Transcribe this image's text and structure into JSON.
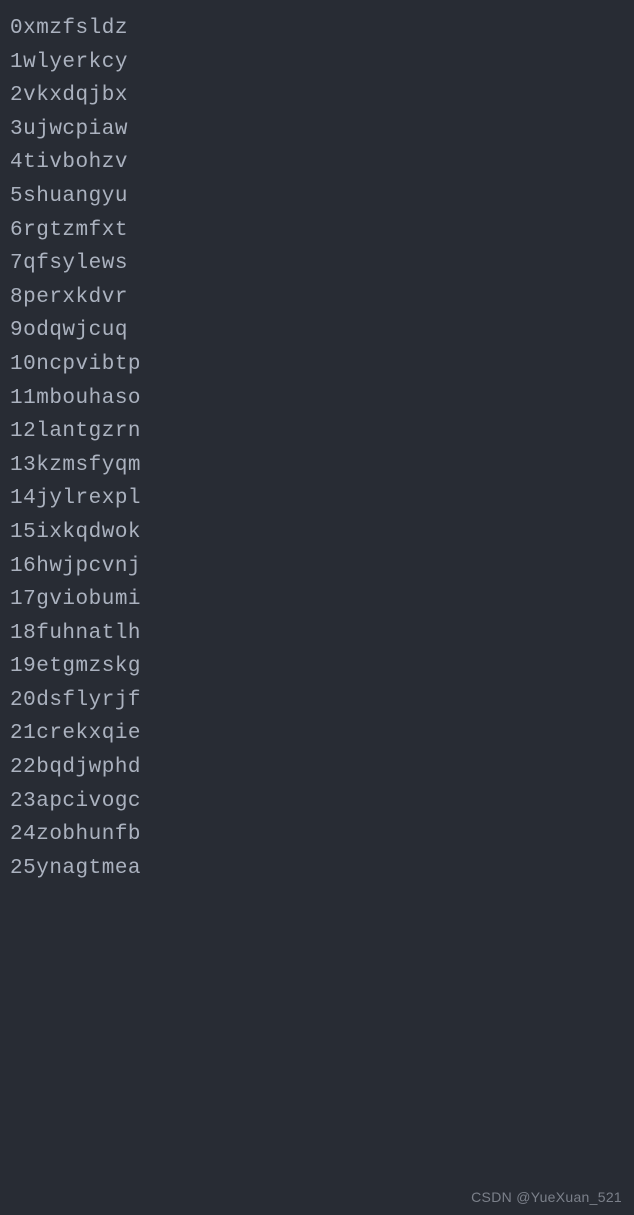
{
  "lines": [
    {
      "index": "0",
      "value": "xmzfsldz"
    },
    {
      "index": "1",
      "value": "wlyerkcy"
    },
    {
      "index": "2",
      "value": "vkxdqjbx"
    },
    {
      "index": "3",
      "value": "ujwcpiaw"
    },
    {
      "index": "4",
      "value": "tivbohzv"
    },
    {
      "index": "5",
      "value": "shuangyu"
    },
    {
      "index": "6",
      "value": "rgtzmfxt"
    },
    {
      "index": "7",
      "value": "qfsylews"
    },
    {
      "index": "8",
      "value": "perxkdvr"
    },
    {
      "index": "9",
      "value": "odqwjcuq"
    },
    {
      "index": "10",
      "value": "ncpvibtp"
    },
    {
      "index": "11",
      "value": "mbouhaso"
    },
    {
      "index": "12",
      "value": "lantgzrn"
    },
    {
      "index": "13",
      "value": "kzmsfyqm"
    },
    {
      "index": "14",
      "value": "jylrexpl"
    },
    {
      "index": "15",
      "value": "ixkqdwok"
    },
    {
      "index": "16",
      "value": "hwjpcvnj"
    },
    {
      "index": "17",
      "value": "gviobumi"
    },
    {
      "index": "18",
      "value": "fuhnatlh"
    },
    {
      "index": "19",
      "value": "etgmzskg"
    },
    {
      "index": "20",
      "value": "dsflyrjf"
    },
    {
      "index": "21",
      "value": "crekxqie"
    },
    {
      "index": "22",
      "value": "bqdjwphd"
    },
    {
      "index": "23",
      "value": "apcivogc"
    },
    {
      "index": "24",
      "value": "zobhunfb"
    },
    {
      "index": "25",
      "value": "ynagtmea"
    }
  ],
  "watermark": "CSDN @YueXuan_521"
}
